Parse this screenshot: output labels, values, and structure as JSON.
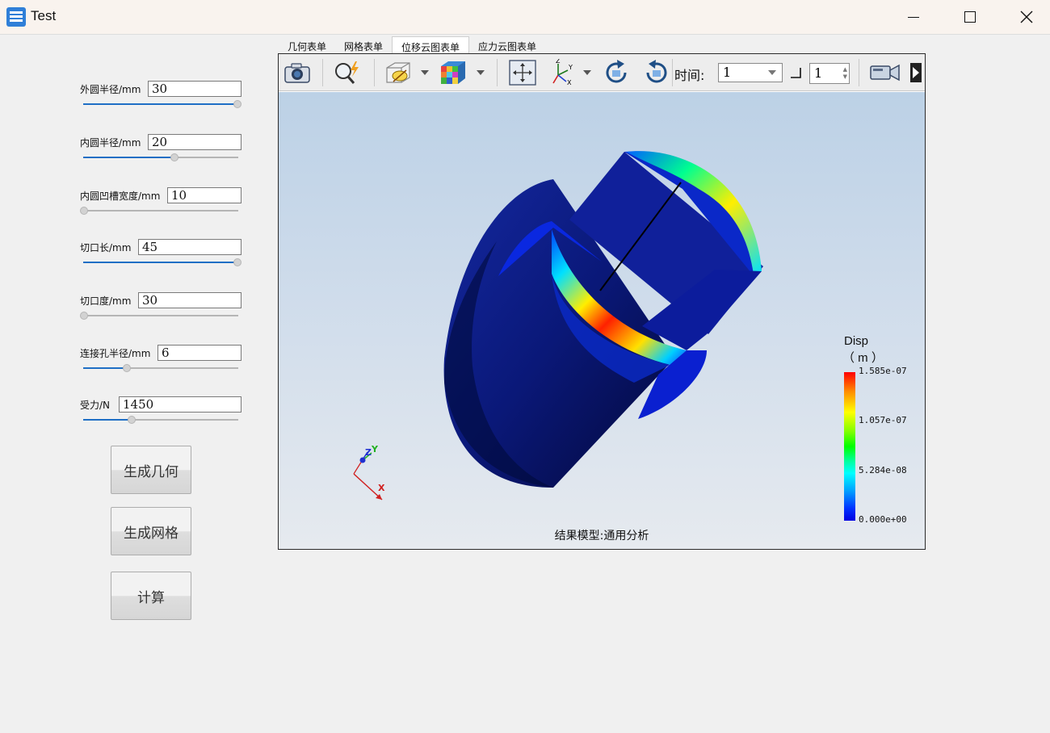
{
  "window": {
    "title": "Test"
  },
  "form": {
    "fields": [
      {
        "label": "外圆半径/mm",
        "value": "30",
        "slider_fraction": 1.0
      },
      {
        "label": "内圆半径/mm",
        "value": "20",
        "slider_fraction": 0.59
      },
      {
        "label": "内圆凹槽宽度/mm",
        "value": "10",
        "slider_fraction": 0.0
      },
      {
        "label": "切口长/mm",
        "value": "45",
        "slider_fraction": 1.0
      },
      {
        "label": "切口度/mm",
        "value": "30",
        "slider_fraction": 0.0
      },
      {
        "label": "连接孔半径/mm",
        "value": "6",
        "slider_fraction": 0.28
      },
      {
        "label": "受力/N",
        "value": "1450",
        "slider_fraction": 0.31
      }
    ],
    "buttons": {
      "generate_geometry": "生成几何",
      "generate_mesh": "生成网格",
      "compute": "计算"
    }
  },
  "tabs": [
    {
      "label": "几何表单",
      "active": false
    },
    {
      "label": "网格表单",
      "active": false
    },
    {
      "label": "位移云图表单",
      "active": true
    },
    {
      "label": "应力云图表单",
      "active": false
    }
  ],
  "toolbar": {
    "icons": [
      "camera-icon",
      "zoom-icon",
      "display-mode-icon",
      "color-cube-icon",
      "fit-view-icon",
      "axes-icon",
      "rotate-cw-icon",
      "rotate-ccw-icon",
      "video-camera-icon"
    ],
    "time_label": "时间:",
    "time_value": "1",
    "step_value": "1"
  },
  "viewer": {
    "legend": {
      "title": "Disp",
      "unit": "（ m ）",
      "max": "1.585e-07",
      "v2": "1.057e-07",
      "v3": "5.284e-08",
      "min": "0.000e+00"
    },
    "result_label": "结果模型:通用分析",
    "triad": {
      "x": "X",
      "y": "Y",
      "z": "Z"
    }
  },
  "colors": {
    "accent": "#1f6fc5",
    "colormap_top": "#ff0000",
    "colormap_bottom": "#0000e0"
  }
}
